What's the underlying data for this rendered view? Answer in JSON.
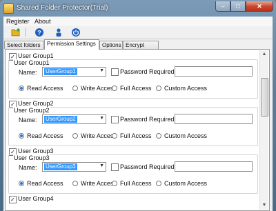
{
  "window": {
    "title": "Shared Folder Protector(Trial)",
    "min": "–",
    "max": "□",
    "close": "✕"
  },
  "menu": [
    "Register",
    "About"
  ],
  "toolbar": [
    {
      "icon": "folder-open-icon",
      "color": "#e6b422"
    },
    {
      "icon": "help-icon",
      "color": "#1f5fbf"
    },
    {
      "icon": "user-icon",
      "color": "#1f5fbf"
    },
    {
      "icon": "power-icon",
      "color": "#1f5fbf"
    }
  ],
  "tabs": [
    "Select folders",
    "Permission Settings",
    "Options",
    "Encrypt Now"
  ],
  "active_tab": 1,
  "name_label": "Name:",
  "password_label": "Password Required",
  "access_options": [
    "Read Access",
    "Write Access",
    "Full Access",
    "Custom Access"
  ],
  "groups": [
    {
      "title": "User Group1",
      "legend": "User Group1",
      "name": "UserGroup1",
      "checked": true,
      "password_required": false,
      "selected_access": "Read Access"
    },
    {
      "title": "User Group2",
      "legend": "User Group2",
      "name": "UserGroup2",
      "checked": true,
      "password_required": false,
      "selected_access": "Read Access"
    },
    {
      "title": "User Group3",
      "legend": "User Group3",
      "name": "UserGroup3",
      "checked": true,
      "password_required": false,
      "selected_access": "Read Access"
    }
  ],
  "partial_group_title": "User Group4"
}
